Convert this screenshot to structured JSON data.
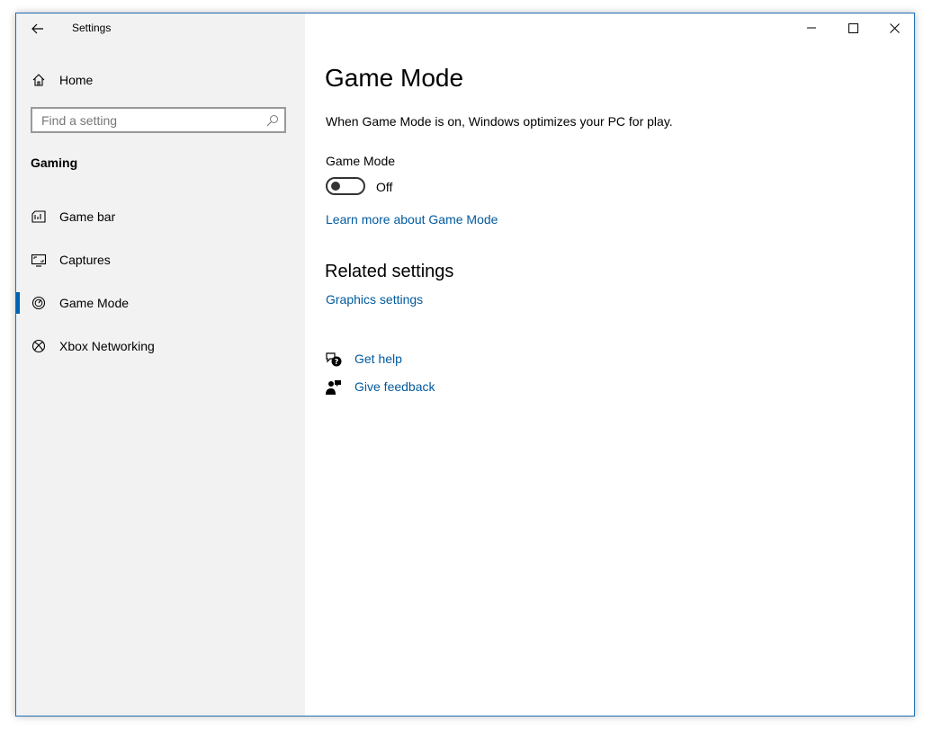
{
  "window": {
    "app_title": "Settings",
    "accent_color": "#0063b1",
    "link_color": "#005a9e"
  },
  "titlebar": {
    "back_icon": "arrow-left-icon",
    "minimize_icon": "minimize-icon",
    "maximize_icon": "maximize-icon",
    "close_icon": "close-icon"
  },
  "sidebar": {
    "home": {
      "label": "Home",
      "icon": "home-icon"
    },
    "search": {
      "placeholder": "Find a setting",
      "icon": "search-icon"
    },
    "section_heading": "Gaming",
    "items": [
      {
        "label": "Game bar",
        "icon": "game-bar-icon",
        "selected": false
      },
      {
        "label": "Captures",
        "icon": "captures-icon",
        "selected": false
      },
      {
        "label": "Game Mode",
        "icon": "game-mode-icon",
        "selected": true
      },
      {
        "label": "Xbox Networking",
        "icon": "xbox-icon",
        "selected": false
      }
    ]
  },
  "main": {
    "title": "Game Mode",
    "description": "When Game Mode is on, Windows optimizes your PC for play.",
    "toggle": {
      "label": "Game Mode",
      "state": "Off",
      "on": false
    },
    "learn_more_link": "Learn more about Game Mode",
    "related": {
      "heading": "Related settings",
      "links": [
        "Graphics settings"
      ]
    },
    "help": {
      "get_help": {
        "label": "Get help",
        "icon": "get-help-icon"
      },
      "give_feedback": {
        "label": "Give feedback",
        "icon": "feedback-icon"
      }
    }
  }
}
